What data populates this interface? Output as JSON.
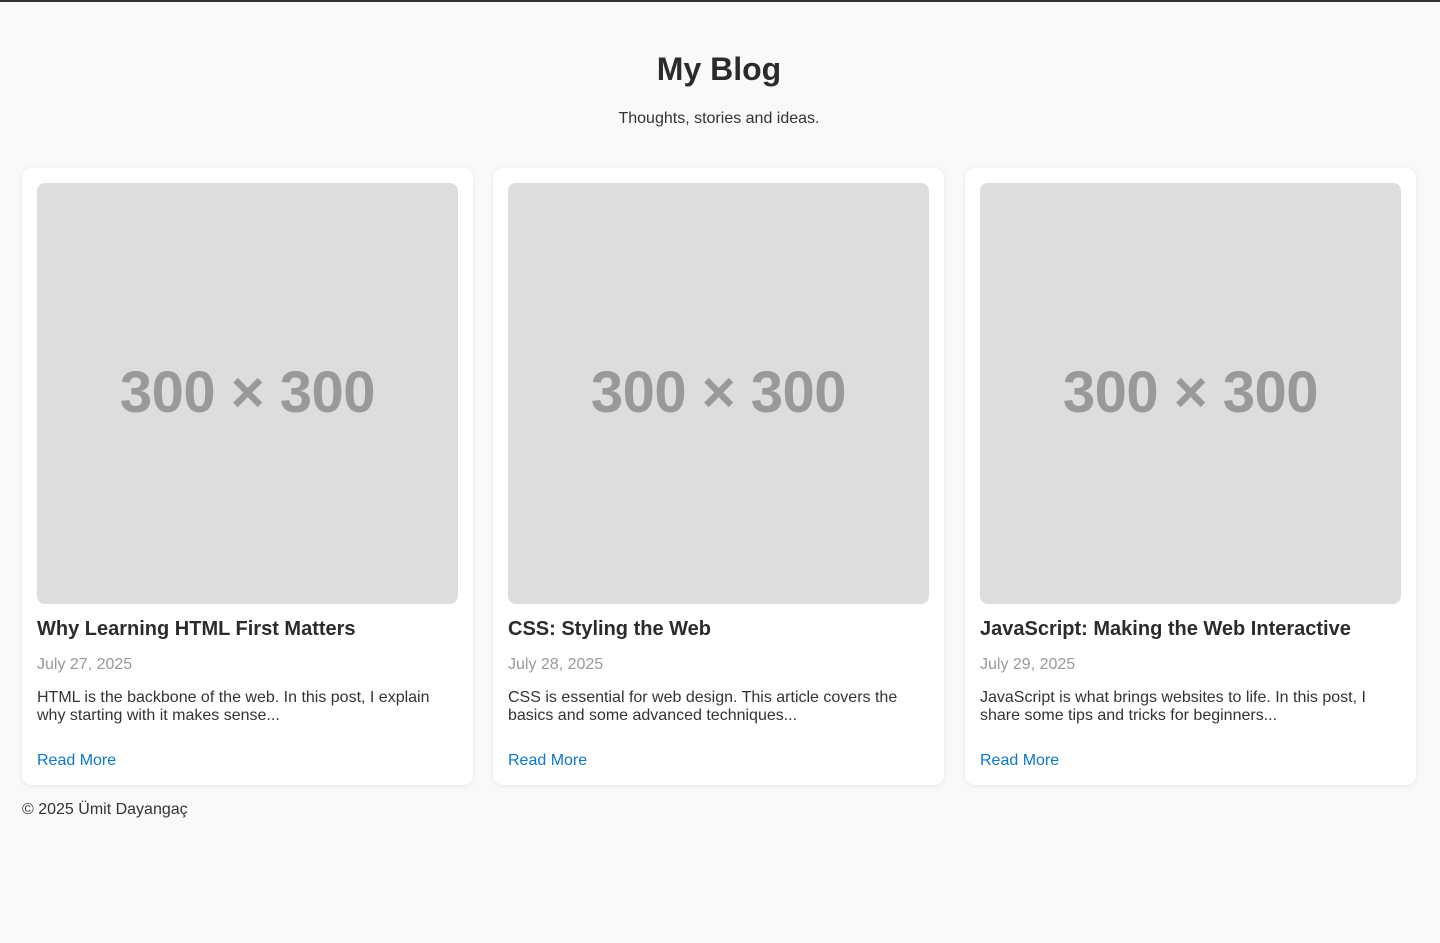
{
  "header": {
    "title": "My Blog",
    "tagline": "Thoughts, stories and ideas."
  },
  "posts": [
    {
      "image_label": "300 × 300",
      "title": "Why Learning HTML First Matters",
      "date": "July 27, 2025",
      "excerpt": "HTML is the backbone of the web. In this post, I explain why starting with it makes sense...",
      "link_label": "Read More"
    },
    {
      "image_label": "300 × 300",
      "title": "CSS: Styling the Web",
      "date": "July 28, 2025",
      "excerpt": "CSS is essential for web design. This article covers the basics and some advanced techniques...",
      "link_label": "Read More"
    },
    {
      "image_label": "300 × 300",
      "title": "JavaScript: Making the Web Interactive",
      "date": "July 29, 2025",
      "excerpt": "JavaScript is what brings websites to life. In this post, I share some tips and tricks for beginners...",
      "link_label": "Read More"
    }
  ],
  "footer": {
    "copyright": "© 2025 Ümit Dayangaç"
  },
  "colors": {
    "background": "#f9f9f9",
    "card": "#ffffff",
    "placeholder": "#dddddd",
    "placeholder_text": "#999999",
    "link": "#0a78d4",
    "date": "#999999",
    "text": "#333333"
  }
}
